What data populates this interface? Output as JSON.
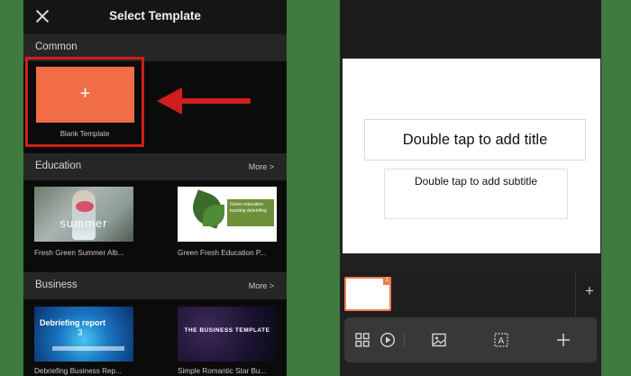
{
  "left_screen": {
    "title": "Select Template",
    "close_icon": "close-icon",
    "common": {
      "section_label": "Common",
      "blank_template": {
        "plus": "+",
        "label": "Blank Template"
      }
    },
    "education": {
      "section_label": "Education",
      "more": "More >",
      "templates": [
        {
          "label": "Fresh Green Summer Alb...",
          "thumb_text": "summer"
        },
        {
          "label": "Green  Fresh Education P...",
          "thumb_text": "Green education tracking debriefing"
        }
      ]
    },
    "business": {
      "section_label": "Business",
      "more": "More >",
      "templates": [
        {
          "label": "Debriefing Business Rep...",
          "thumb_text": "Debriefing report",
          "thumb_num": "3"
        },
        {
          "label": "Simple Romantic Star Bu...",
          "thumb_text": "THE BUSINESS TEMPLATE"
        }
      ]
    }
  },
  "annotation": {
    "highlight_color": "#d21d1d",
    "arrow_icon": "arrow-left-icon"
  },
  "right_screen": {
    "slide": {
      "title_placeholder": "Double tap to add title",
      "subtitle_placeholder": "Double tap to add subtitle"
    },
    "slide_thumbnail_number": "1",
    "add_slide": "+",
    "toolbar": [
      {
        "icon": "layout-grid-icon"
      },
      {
        "icon": "play-icon"
      },
      {
        "icon": "image-icon"
      },
      {
        "icon": "text-box-icon"
      },
      {
        "icon": "plus-icon"
      }
    ]
  },
  "colors": {
    "accent": "#f16d45",
    "background": "#3f7a3f"
  }
}
